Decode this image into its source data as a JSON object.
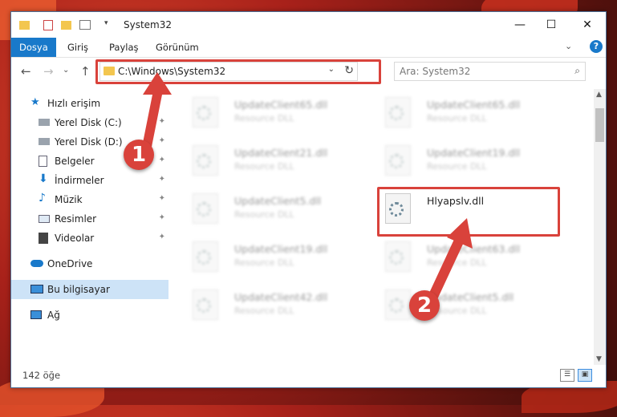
{
  "window": {
    "title": "System32",
    "controls": {
      "minimize": "—",
      "maximize": "☐",
      "close": "✕"
    }
  },
  "ribbon": {
    "tabs": [
      {
        "label": "Dosya",
        "active": true
      },
      {
        "label": "Giriş",
        "active": false
      },
      {
        "label": "Paylaş",
        "active": false
      },
      {
        "label": "Görünüm",
        "active": false
      }
    ],
    "expand_glyph": "⌄",
    "help_glyph": "?"
  },
  "nav": {
    "back": "←",
    "forward": "→",
    "recent": "⌄",
    "up": "↑",
    "address": "C:\\Windows\\System32",
    "address_dropdown": "⌄",
    "refresh": "↻",
    "search_placeholder": "Ara: System32",
    "search_icon": "⌕"
  },
  "sidebar": {
    "items": [
      {
        "label": "Hızlı erişim",
        "icon": "star-icon",
        "pinned": false
      },
      {
        "label": "Yerel Disk (C:)",
        "icon": "drive-icon",
        "pinned": true
      },
      {
        "label": "Yerel Disk (D:)",
        "icon": "drive-icon",
        "pinned": true
      },
      {
        "label": "Belgeler",
        "icon": "documents-icon",
        "pinned": true
      },
      {
        "label": "İndirmeler",
        "icon": "download-icon",
        "pinned": true
      },
      {
        "label": "Müzik",
        "icon": "music-icon",
        "pinned": true
      },
      {
        "label": "Resimler",
        "icon": "pictures-icon",
        "pinned": true
      },
      {
        "label": "Videolar",
        "icon": "video-icon",
        "pinned": true
      },
      {
        "label": "OneDrive",
        "icon": "cloud-icon",
        "pinned": false
      },
      {
        "label": "Bu bilgisayar",
        "icon": "computer-icon",
        "pinned": false,
        "selected": true
      },
      {
        "label": "Ağ",
        "icon": "network-icon",
        "pinned": false
      }
    ],
    "pin_glyph": "📌"
  },
  "files": [
    {
      "name": "UpdateClient65.dll",
      "type": "Resource DLL"
    },
    {
      "name": "UpdateClient65.dll",
      "type": "Resource DLL"
    },
    {
      "name": "UpdateClient21.dll",
      "type": "Resource DLL"
    },
    {
      "name": "UpdateClient19.dll",
      "type": "Resource DLL"
    },
    {
      "name": "UpdateClient5.dll",
      "type": "Resource DLL"
    },
    {
      "name": "Hlyapslv.dll",
      "type": ""
    },
    {
      "name": "UpdateClient19.dll",
      "type": "Resource DLL"
    },
    {
      "name": "UpdateClient63.dll",
      "type": "Resource DLL"
    },
    {
      "name": "UpdateClient42.dll",
      "type": "Resource DLL"
    },
    {
      "name": "UpdateClient5.dll",
      "type": "Resource DLL"
    }
  ],
  "status": {
    "item_count": "142 öğe"
  },
  "annotations": {
    "step1": "1",
    "step2": "2",
    "accent": "#d9423b"
  },
  "colors": {
    "ribbon_active": "#1979ca",
    "selection": "#cde3f7"
  }
}
